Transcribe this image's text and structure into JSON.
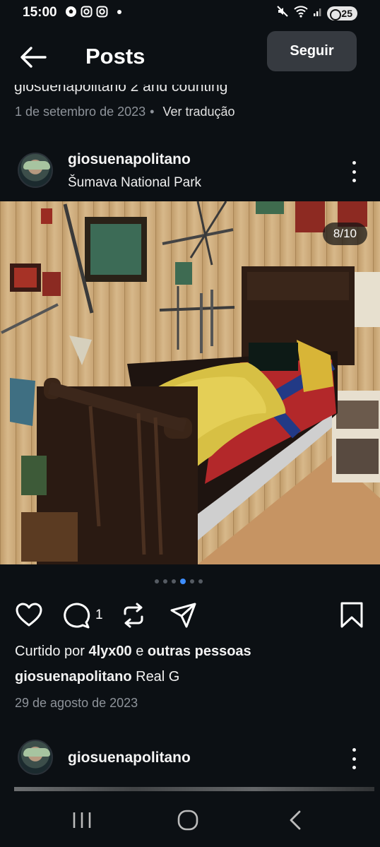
{
  "status_bar": {
    "time": "15:00",
    "battery": "25"
  },
  "header": {
    "title": "Posts",
    "follow_label": "Seguir"
  },
  "previous_post": {
    "caption_fragment": "giosuenapolitano 2 and counting",
    "date": "1 de setembro de 2023",
    "separator": "•",
    "translate_label": "Ver tradução"
  },
  "post": {
    "username": "giosuenapolitano",
    "location": "Šumava National Park",
    "image_counter": "8/10",
    "carousel": {
      "count": 6,
      "active_index": 3
    },
    "comment_count": "1",
    "likes": {
      "prefix": "Curtido por ",
      "user": "4lyx00",
      "mid": " e ",
      "others": "outras pessoas"
    },
    "caption": {
      "user": "giosuenapolitano",
      "text": " Real G"
    },
    "date": "29 de agosto de 2023"
  },
  "next_post": {
    "username": "giosuenapolitano"
  },
  "icons": [
    "back-arrow-icon",
    "more-icon",
    "like-heart-icon",
    "comment-icon",
    "repost-icon",
    "share-icon",
    "save-bookmark-icon",
    "recents-icon",
    "home-icon",
    "nav-back-icon"
  ]
}
